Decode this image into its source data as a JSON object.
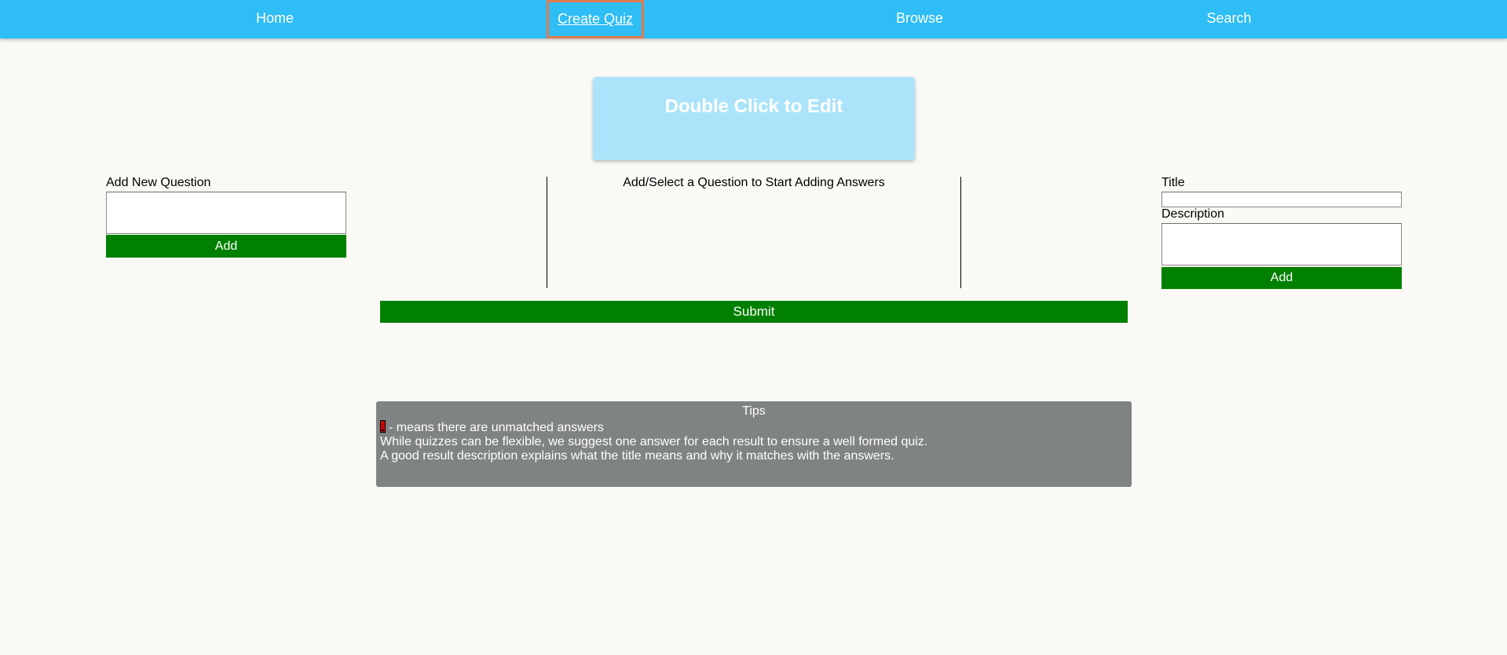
{
  "nav": {
    "items": [
      {
        "label": "Home"
      },
      {
        "label": "Create Quiz",
        "active": true
      },
      {
        "label": "Browse"
      },
      {
        "label": "Search"
      }
    ]
  },
  "title_card": {
    "text": "Double Click to Edit"
  },
  "question_panel": {
    "label": "Add New Question",
    "input_value": "",
    "add_label": "Add"
  },
  "answer_panel": {
    "message": "Add/Select a Question to Start Adding Answers"
  },
  "result_panel": {
    "title_label": "Title",
    "title_value": "",
    "description_label": "Description",
    "description_value": "",
    "add_label": "Add"
  },
  "submit_label": "Submit",
  "tips": {
    "title": "Tips",
    "lines": [
      "- means there are unmatched answers",
      "While quizzes can be flexible, we suggest one answer for each result to ensure a well formed quiz.",
      "A good result description explains what the title means and why it matches with the answers."
    ]
  },
  "colors": {
    "nav_bg": "#2ebdf5",
    "page_bg": "#fbf9f5",
    "button_green": "#008000",
    "title_card_bg": "#abe4fa",
    "tips_bg": "#808383",
    "active_outline": "#e07a4e",
    "warning_red": "#d40000"
  }
}
